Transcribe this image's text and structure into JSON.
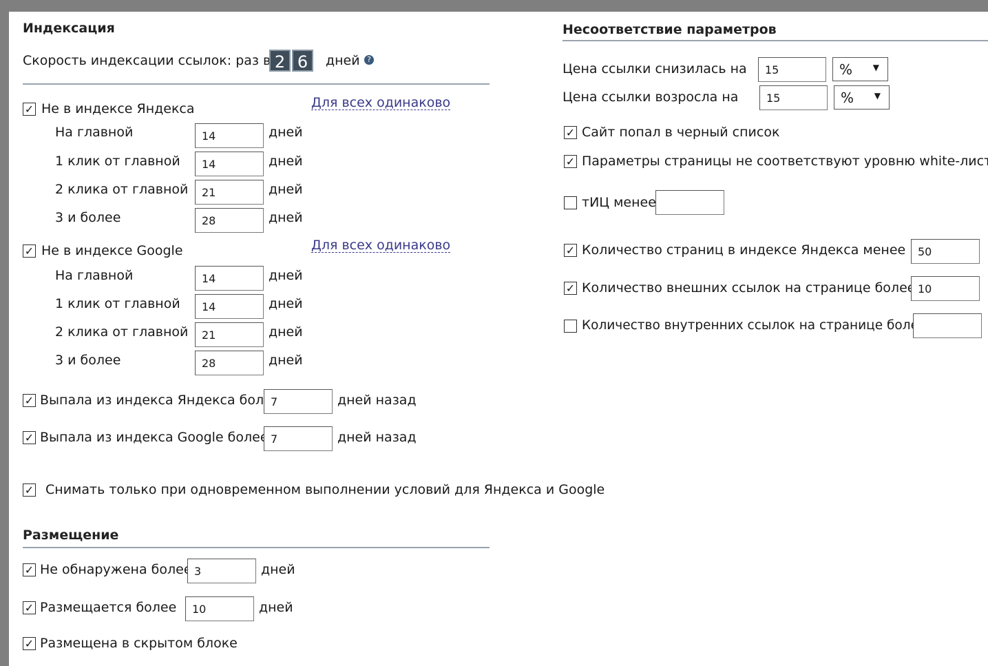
{
  "indexing": {
    "title": "Индексация",
    "speed_label": "Скорость индексации ссылок: раз в",
    "speed_digits": [
      "2",
      "6"
    ],
    "speed_unit": "дней",
    "help_glyph": "?",
    "yandex": {
      "label": "Не в индексе Яндекса",
      "checked": true,
      "same_for_all": "Для всех одинаково",
      "rows": [
        {
          "label": "На главной",
          "value": "14",
          "unit": "дней"
        },
        {
          "label": "1 клик от главной",
          "value": "14",
          "unit": "дней"
        },
        {
          "label": "2 клика от главной",
          "value": "21",
          "unit": "дней"
        },
        {
          "label": "3 и более",
          "value": "28",
          "unit": "дней"
        }
      ]
    },
    "google": {
      "label": "Не в индексе Google",
      "checked": true,
      "same_for_all": "Для всех одинаково",
      "rows": [
        {
          "label": "На главной",
          "value": "14",
          "unit": "дней"
        },
        {
          "label": "1 клик от главной",
          "value": "14",
          "unit": "дней"
        },
        {
          "label": "2 клика от главной",
          "value": "21",
          "unit": "дней"
        },
        {
          "label": "3 и более",
          "value": "28",
          "unit": "дней"
        }
      ]
    },
    "dropped_yandex": {
      "label": "Выпала из индекса Яндекса более",
      "value": "7",
      "unit": "дней назад",
      "checked": true
    },
    "dropped_google": {
      "label": "Выпала из индекса Google более",
      "value": "7",
      "unit": "дней назад",
      "checked": true
    },
    "simultaneous": {
      "label": "Снимать только при одновременном выполнении условий для Яндекса и Google",
      "checked": true
    }
  },
  "placement": {
    "title": "Размещение",
    "not_found": {
      "label": "Не обнаружена более",
      "value": "3",
      "unit": "дней",
      "checked": true
    },
    "placed_more": {
      "label": "Размещается более",
      "value": "10",
      "unit": "дней",
      "checked": true
    },
    "hidden_block": {
      "label": "Размещена в скрытом блоке",
      "checked": true
    }
  },
  "mismatch": {
    "title": "Несоответствие параметров",
    "price_down": {
      "label": "Цена ссылки снизилась на",
      "value": "15",
      "unit": "%"
    },
    "price_up": {
      "label": "Цена ссылки возросла на",
      "value": "15",
      "unit": "%"
    },
    "blacklist": {
      "label": "Сайт попал в черный список",
      "checked": true
    },
    "whitelist": {
      "label": "Параметры страницы не соответствуют уровню white-листа",
      "checked": true
    },
    "tic": {
      "label": "тИЦ менее",
      "value": "",
      "checked": false
    },
    "pages_yandex": {
      "label": "Количество страниц в индексе Яндекса менее",
      "value": "50",
      "checked": true
    },
    "external_links": {
      "label": "Количество внешних ссылок на странице более",
      "value": "10",
      "checked": true
    },
    "internal_links": {
      "label": "Количество внутренних ссылок на странице более",
      "value": "",
      "checked": false
    }
  },
  "check_glyph": "✓"
}
